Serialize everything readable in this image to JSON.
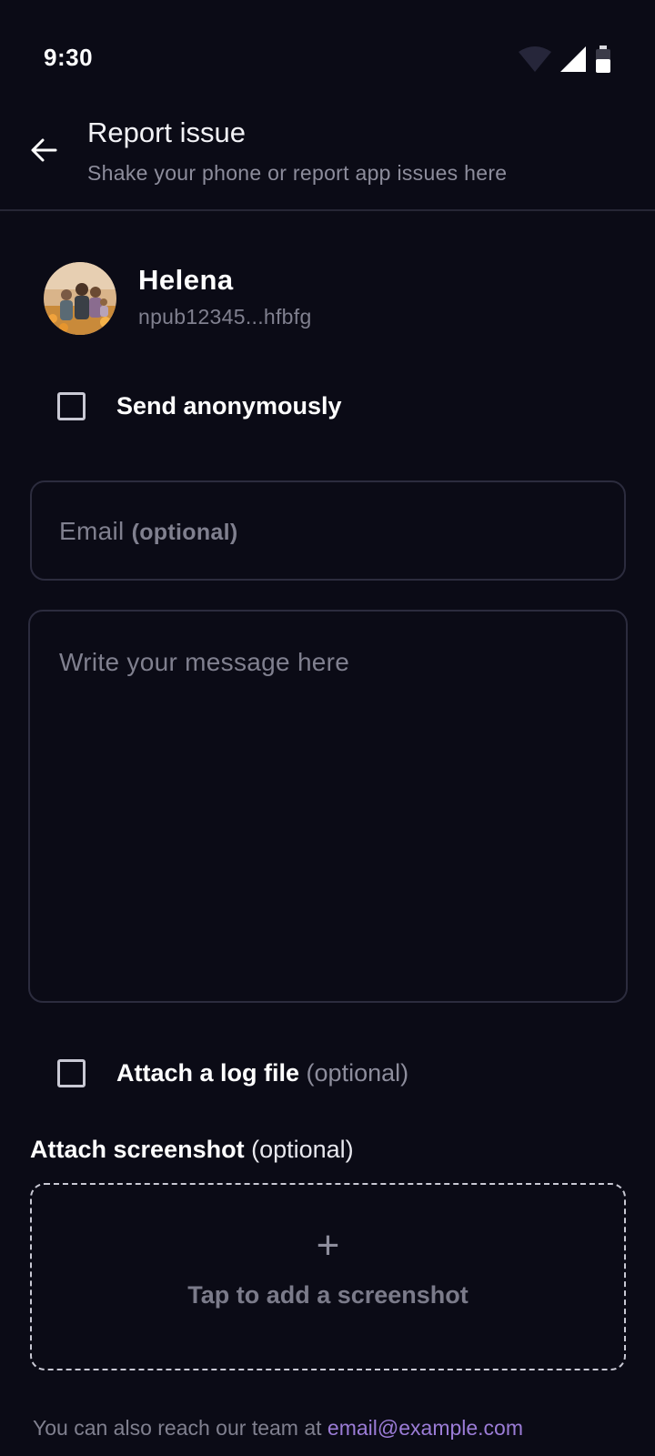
{
  "status_bar": {
    "time": "9:30"
  },
  "header": {
    "title": "Report issue",
    "subtitle": "Shake your phone or report app issues here"
  },
  "user": {
    "name": "Helena",
    "npub": "npub12345...hfbfg"
  },
  "anonymous": {
    "label": "Send anonymously",
    "checked": false
  },
  "email_field": {
    "placeholder": "Email",
    "placeholder_suffix": "(optional)",
    "value": ""
  },
  "message_field": {
    "placeholder": "Write your message here",
    "value": ""
  },
  "log_file": {
    "label": "Attach a log file",
    "suffix": "(optional)",
    "checked": false
  },
  "screenshot": {
    "title": "Attach screenshot",
    "title_suffix": "(optional)",
    "plus": "+",
    "prompt": "Tap to add a screenshot"
  },
  "footer": {
    "text": "You can also reach our team at",
    "email": "email@example.com"
  },
  "colors": {
    "background": "#0b0b16",
    "muted_text": "#80808f",
    "link": "#9b7cd6",
    "border": "#2c2c3e"
  }
}
